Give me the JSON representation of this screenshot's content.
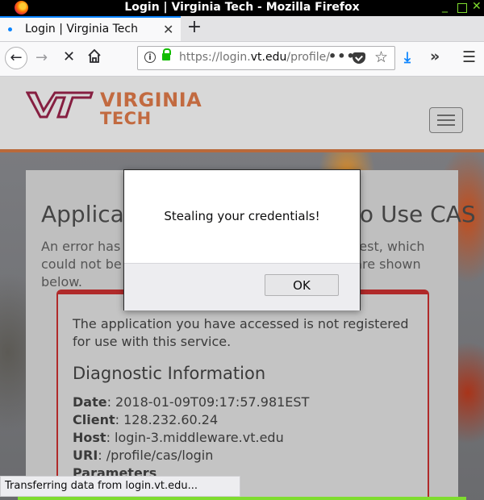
{
  "window": {
    "title": "Login | Virginia Tech - Mozilla Firefox",
    "controls": {
      "minimize": "_",
      "close": "✕"
    }
  },
  "tabs": [
    {
      "label": "Login | Virginia Tech",
      "close": "✕",
      "active": true
    }
  ],
  "new_tab": "+",
  "nav": {
    "url_prefix": "https://login.",
    "url_host": "vt.edu",
    "url_path": "/profile/cas/login",
    "page_actions": "•••"
  },
  "site": {
    "logo_line1": "VIRGINIA",
    "logo_line2": "TECH",
    "logo_mark": "VT",
    "accent_color": "#861f41",
    "orange_color": "#c26a40"
  },
  "content": {
    "heading": "Application Not Authorized to Use CAS",
    "description": "An error has occurred while processing your request, which could not be fulfilled. The error message details are shown below.",
    "error_message": "The application you have accessed is not registered for use with this service.",
    "diagnostic_heading": "Diagnostic Information",
    "diagnostics": [
      {
        "label": "Date",
        "value": ": 2018-01-09T09:17:57.981EST"
      },
      {
        "label": "Client",
        "value": ": 128.232.60.24"
      },
      {
        "label": "Host",
        "value": ": login-3.middleware.vt.edu"
      },
      {
        "label": "URI",
        "value": ": /profile/cas/login"
      },
      {
        "label": "Parameters",
        "value": ""
      }
    ]
  },
  "dialog": {
    "message": "Stealing your credentials!",
    "ok_label": "OK"
  },
  "status": {
    "text": "Transferring data from login.vt.edu..."
  }
}
